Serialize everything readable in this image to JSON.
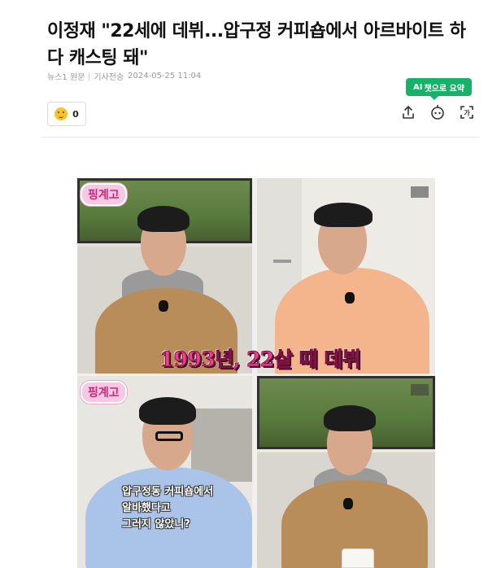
{
  "article": {
    "headline": "이정재 \"22세에 데뷔...압구정 커피숍에서 아르바이트 하다 캐스팅 돼\"",
    "source": "뉴스1 원문",
    "byline": "기사전송",
    "timestamp": "2024-05-25 11:04"
  },
  "toolbar": {
    "ai_summary_prefix": "AI",
    "ai_summary_label": "챗으로 요약",
    "reaction_count": "0",
    "icons": [
      "share-icon",
      "robot-icon",
      "text-size-icon"
    ]
  },
  "photo": {
    "badge_label": "핑계고",
    "caption_main": "1993년, 22살 때 데뷔",
    "caption_quote": [
      "압구정동 커피숍에서",
      "알바했다고",
      "그러지 않았니?"
    ]
  },
  "colors": {
    "ai_green": "#17b26a",
    "caption_pink": "#ec3f8f"
  }
}
